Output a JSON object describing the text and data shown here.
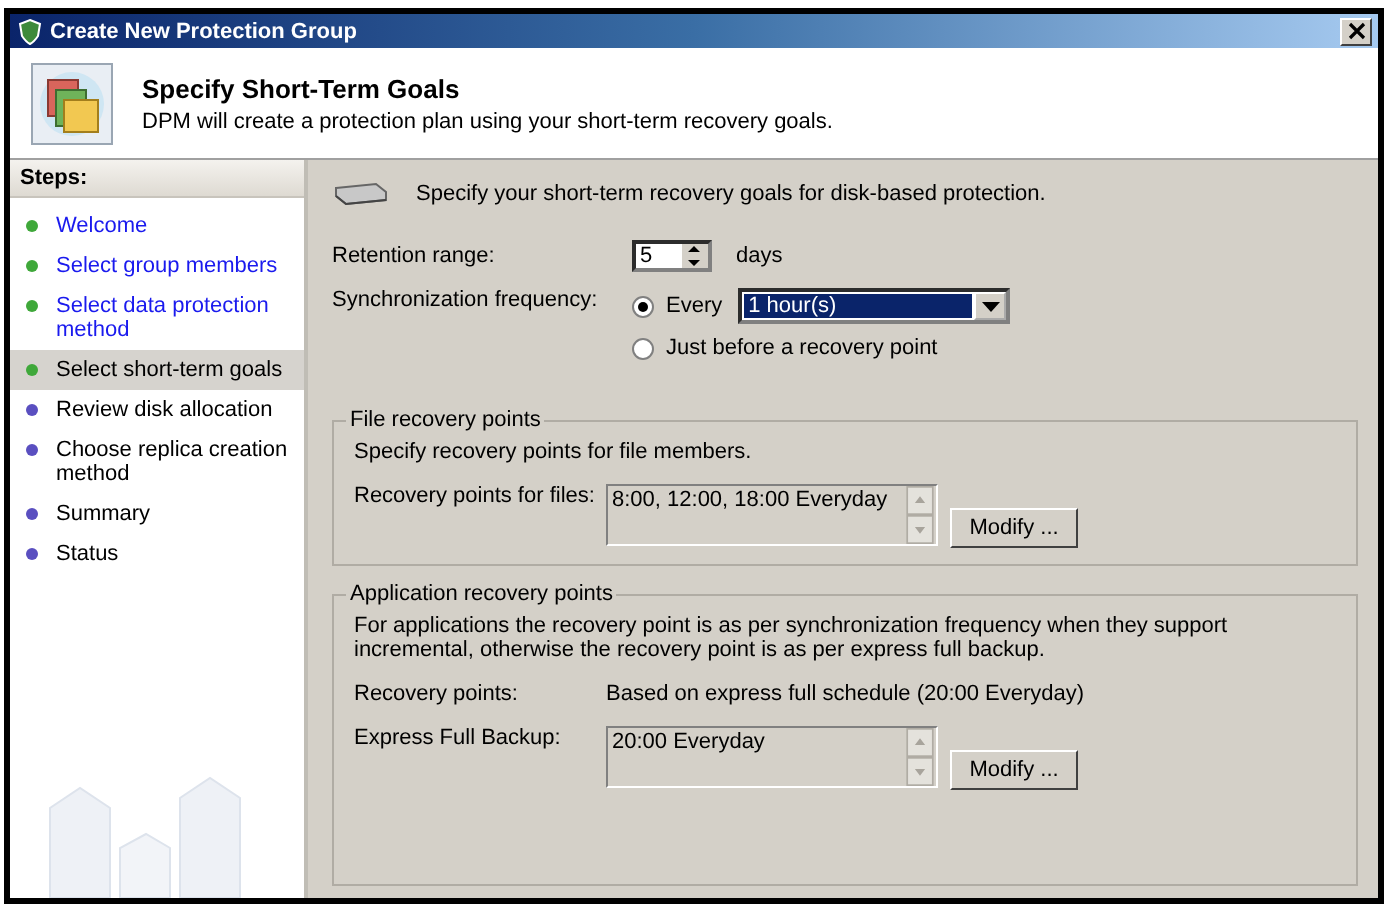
{
  "window": {
    "title": "Create New Protection Group"
  },
  "header": {
    "title": "Specify Short-Term Goals",
    "subtitle": "DPM will create a protection plan using your short-term recovery goals."
  },
  "steps": {
    "heading": "Steps:",
    "items": [
      {
        "label": "Welcome",
        "color": "#3fa83a",
        "link": true,
        "selected": false
      },
      {
        "label": "Select group members",
        "color": "#3fa83a",
        "link": true,
        "selected": false
      },
      {
        "label": "Select data protection method",
        "color": "#3fa83a",
        "link": true,
        "selected": false
      },
      {
        "label": "Select short-term goals",
        "color": "#3fa83a",
        "link": false,
        "selected": true
      },
      {
        "label": "Review disk allocation",
        "color": "#5a4fc0",
        "link": false,
        "selected": false
      },
      {
        "label": "Choose replica creation method",
        "color": "#5a4fc0",
        "link": false,
        "selected": false
      },
      {
        "label": "Summary",
        "color": "#5a4fc0",
        "link": false,
        "selected": false
      },
      {
        "label": "Status",
        "color": "#5a4fc0",
        "link": false,
        "selected": false
      }
    ]
  },
  "intro": "Specify your short-term recovery goals for disk-based protection.",
  "retention": {
    "label": "Retention range:",
    "value": "5",
    "unit": "days"
  },
  "sync": {
    "label": "Synchronization frequency:",
    "interval": "1 hour(s)",
    "options": [
      {
        "label": "Every",
        "selected": true
      },
      {
        "label": "Just before a recovery point",
        "selected": false
      }
    ]
  },
  "file_points": {
    "title": "File recovery points",
    "description": "Specify recovery points for file members.",
    "label": "Recovery points for files:",
    "value": "8:00, 12:00, 18:00 Everyday",
    "button": "Modify ..."
  },
  "app_points": {
    "title": "Application recovery points",
    "description": "For applications the recovery point is as per synchronization frequency when they support incremental, otherwise the recovery point is as per express full backup.",
    "points_label": "Recovery points:",
    "points_value": "Based on express full schedule (20:00 Everyday)",
    "backup_label": "Express Full Backup:",
    "backup_value": "20:00 Everyday",
    "button": "Modify ..."
  }
}
